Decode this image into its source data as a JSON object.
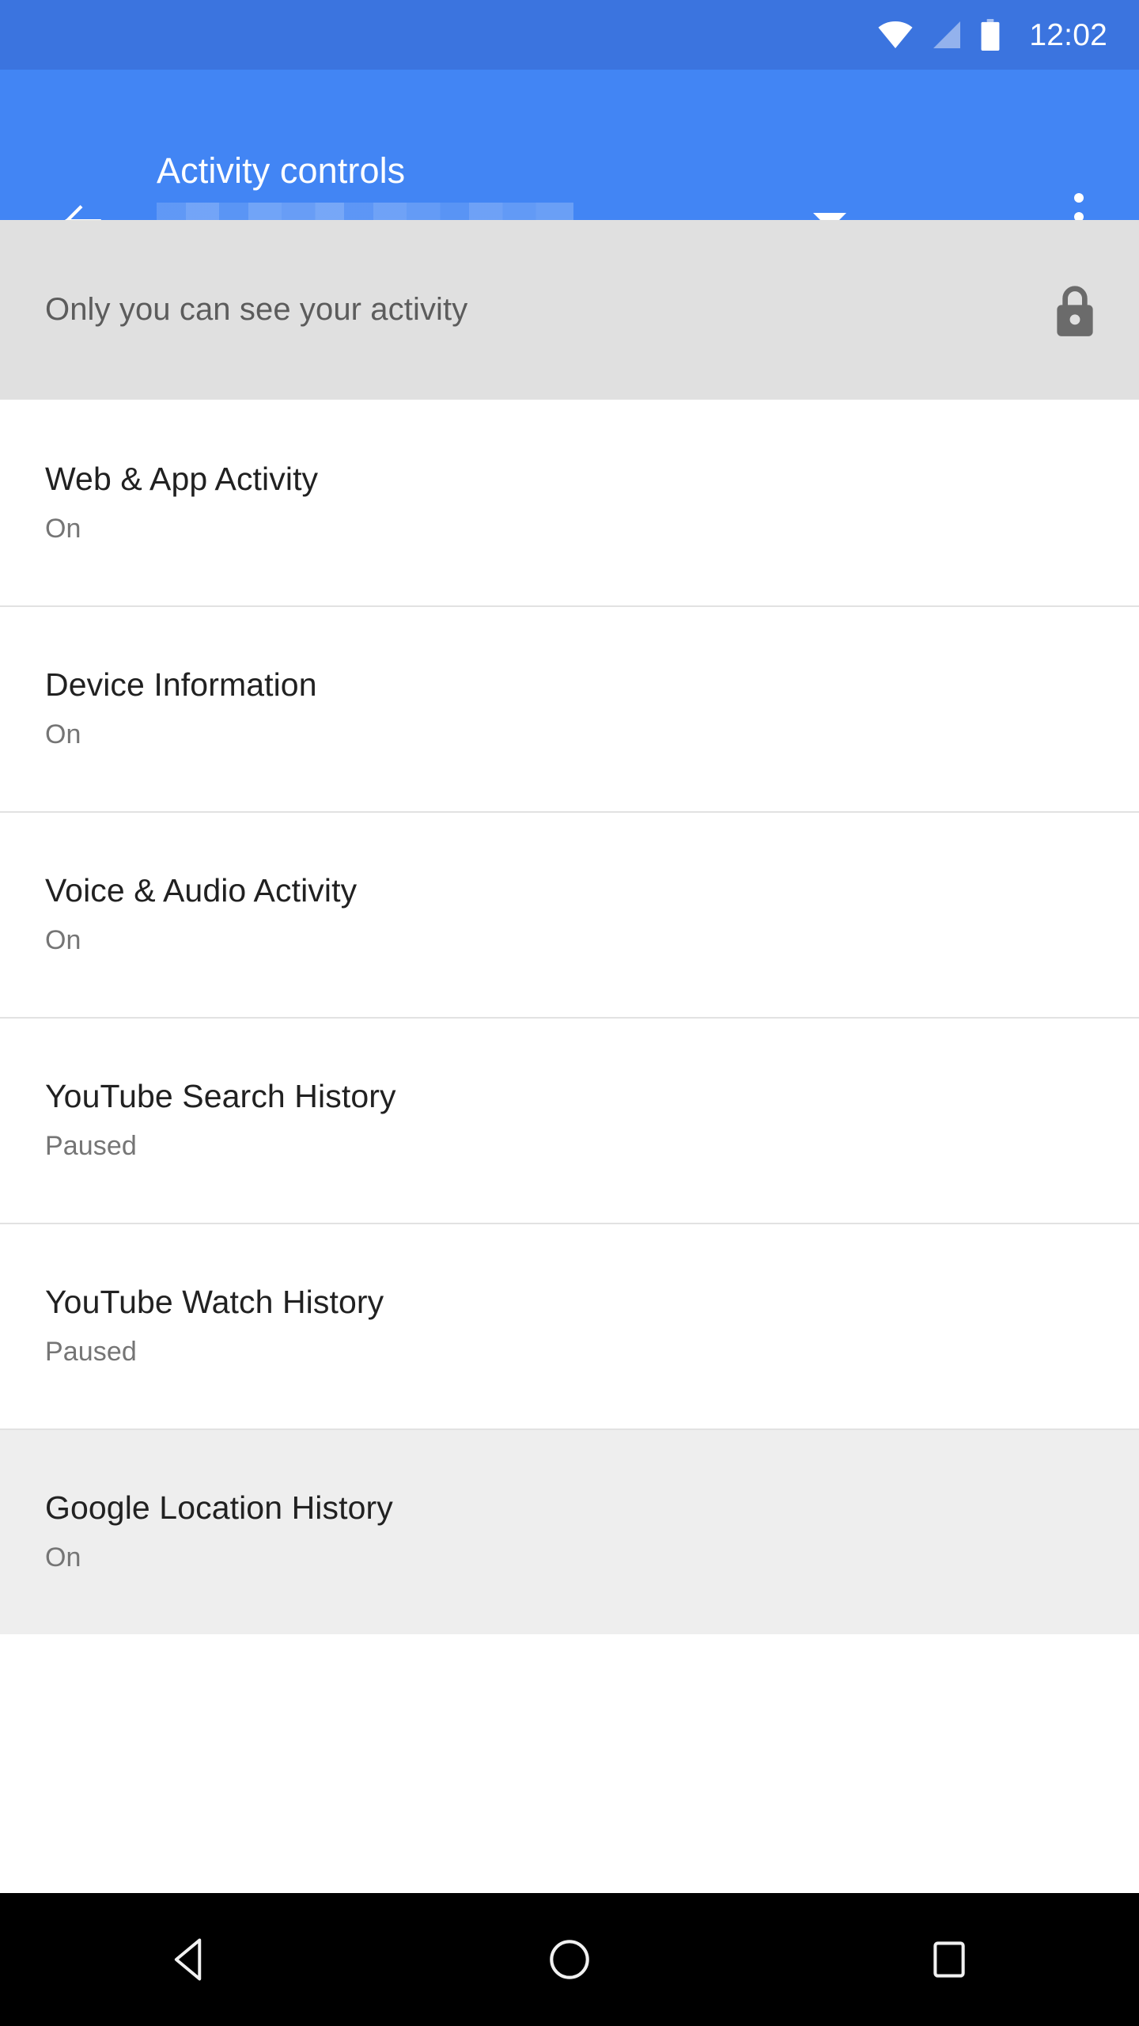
{
  "status_bar": {
    "time": "12:02",
    "icons": [
      "wifi-icon",
      "cell-signal-icon",
      "battery-icon"
    ],
    "background_color": "#3b74df"
  },
  "app_bar": {
    "back_icon": "back-arrow-icon",
    "title": "Activity controls",
    "account_subtitle": "",
    "account_subtitle_redacted": true,
    "dropdown_icon": "chevron-down-icon",
    "overflow_icon": "more-vert-icon",
    "background_color": "#4285f4"
  },
  "privacy_banner": {
    "text": "Only you can see your activity",
    "icon": "lock-icon",
    "background_color": "#e0e0e0"
  },
  "activity_list": {
    "items": [
      {
        "title": "Web & App Activity",
        "status": "On",
        "highlighted": false
      },
      {
        "title": "Device Information",
        "status": "On",
        "highlighted": false
      },
      {
        "title": "Voice & Audio Activity",
        "status": "On",
        "highlighted": false
      },
      {
        "title": "YouTube Search History",
        "status": "Paused",
        "highlighted": false
      },
      {
        "title": "YouTube Watch History",
        "status": "Paused",
        "highlighted": false
      },
      {
        "title": "Google Location History",
        "status": "On",
        "highlighted": true
      }
    ]
  },
  "nav_bar": {
    "back_label": "Back",
    "home_label": "Home",
    "recents_label": "Recents",
    "background_color": "#000000"
  }
}
